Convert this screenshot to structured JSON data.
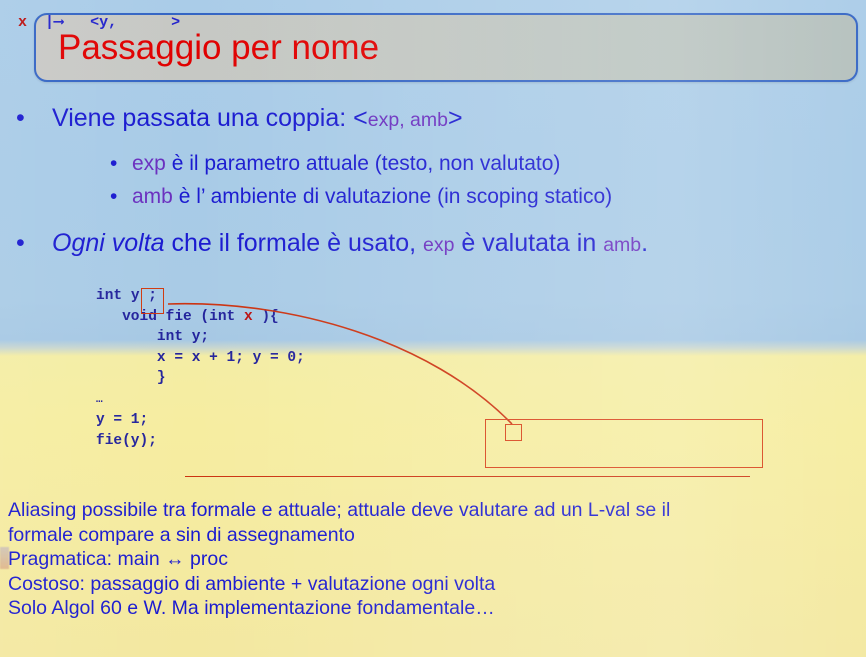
{
  "slide": {
    "title": "Passaggio per nome",
    "background": {
      "top_color": "#aacce8",
      "bottom_color": "#f4eda4"
    },
    "title_box": {
      "border_color": "#3465c4",
      "fill_from": "#c9c9c6",
      "fill_to": "#b4c0bd",
      "text_color": "#e00000"
    }
  },
  "bullets": [
    {
      "marker": "•",
      "level": 1,
      "parts": [
        {
          "text": "Viene passata una coppia: <",
          "style": "normal"
        },
        {
          "text": "exp, amb",
          "style": "small-kw"
        },
        {
          "text": ">",
          "style": "normal"
        }
      ]
    },
    {
      "marker": "•",
      "level": 2,
      "parts": [
        {
          "text": "exp",
          "style": "kw"
        },
        {
          "text": " è il parametro attuale (testo, non valutato)",
          "style": "normal"
        }
      ]
    },
    {
      "marker": "•",
      "level": 2,
      "parts": [
        {
          "text": "amb",
          "style": "kw"
        },
        {
          "text": " è l’ ambiente di valutazione (in scoping statico)",
          "style": "normal"
        }
      ]
    },
    {
      "marker": "•",
      "level": 1,
      "parts": [
        {
          "text": "Ogni volta",
          "style": "italic"
        },
        {
          "text": " che il formale è usato, ",
          "style": "normal"
        },
        {
          "text": "exp",
          "style": "small-kw"
        },
        {
          "text": " è valutata in ",
          "style": "normal"
        },
        {
          "text": "amb",
          "style": "small-kw"
        },
        {
          "text": ".",
          "style": "normal"
        }
      ]
    }
  ],
  "bullet_text_plain": {
    "b1": "Viene passata una coppia: <exp, amb>",
    "b2": "exp è il parametro attuale (testo, non valutato)",
    "b3": "amb è l’ ambiente di valutazione (in scoping statico)",
    "b4": "Ogni volta che il formale è usato, exp è valutata in amb."
  },
  "code": {
    "lines": [
      "int  y  ;",
      "   void fie (int x ){",
      "       int y;",
      "       x = x + 1; y = 0;",
      "       }",
      "…",
      "y = 1;",
      "fie(y);"
    ],
    "line1_pre": "int ",
    "line1_var": "y",
    "line1_post": " ;",
    "line2_a": "   void fie (int ",
    "line2_red": "x",
    "line2_b": " ){",
    "line3": "       int y;",
    "line4": "       x = x + 1; y = 0;",
    "line5": "       }",
    "line6": "…",
    "line7": "y = 1;",
    "line8": "fie(y);",
    "text_color": "#23239c",
    "highlight_color": "#bb1111"
  },
  "env_box": {
    "formal": "x",
    "maps_to": "|⟶",
    "pair_open": "<y,",
    "pair_close": ">",
    "border_color": "#d8431a",
    "formal_color": "#bb1111",
    "arrow_color": "#2222cc"
  },
  "notes": {
    "line1": "Aliasing possibile tra formale e attuale; attuale deve valutare ad un L-val se il",
    "line2": "formale compare a sin di assegnamento",
    "line3": "Pragmatica: main ↔ proc",
    "line4": "Costoso: passaggio di ambiente + valutazione ogni volta",
    "line5": "Solo Algol 60 e W. Ma implementazione fondamentale…",
    "text_color": "#1a1ad0"
  }
}
